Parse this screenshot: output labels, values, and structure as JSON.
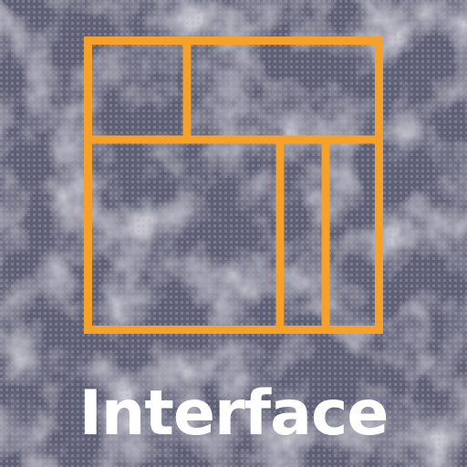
{
  "title": "Interface",
  "icon": {
    "name": "window-layout-icon",
    "stroke_color": "#f6a12a"
  },
  "colors": {
    "background": "#5d6076",
    "speckle_light": "#a9a5b3",
    "speckle_dark": "#4c4f63",
    "text": "#ffffff"
  }
}
